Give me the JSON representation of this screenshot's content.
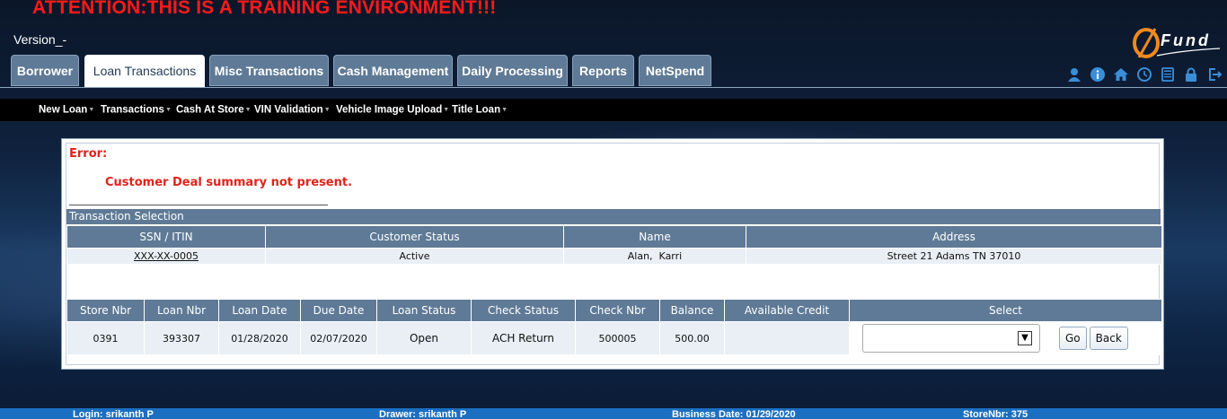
{
  "banner": {
    "attention": "ATTENTION:THIS IS A TRAINING ENVIRONMENT!!!",
    "version": "Version_-"
  },
  "logo": {
    "text": "Fund"
  },
  "tabs": [
    {
      "label": "Borrower"
    },
    {
      "label": "Loan Transactions",
      "active": true
    },
    {
      "label": "Misc Transactions"
    },
    {
      "label": "Cash Management"
    },
    {
      "label": "Daily Processing"
    },
    {
      "label": "Reports"
    },
    {
      "label": "NetSpend"
    }
  ],
  "toolbar_icons": [
    "user-icon",
    "info-icon",
    "home-icon",
    "clock-icon",
    "calculator-icon",
    "lock-icon",
    "logout-icon"
  ],
  "subnav": [
    {
      "label": "New Loan"
    },
    {
      "label": "Transactions"
    },
    {
      "label": "Cash At Store"
    },
    {
      "label": "VIN Validation"
    },
    {
      "label": "Vehicle Image Upload"
    },
    {
      "label": "Title Loan"
    }
  ],
  "error": {
    "title": "Error:",
    "message": "Customer Deal summary not present."
  },
  "section": {
    "title": "Transaction Selection"
  },
  "customer_table": {
    "headers": [
      "SSN / ITIN",
      "Customer Status",
      "Name",
      "Address"
    ],
    "row": {
      "ssn": "XXX-XX-0005",
      "status": "Active",
      "name": "Alan,  Karri",
      "address": "Street 21 Adams TN 37010"
    }
  },
  "loan_table": {
    "headers": [
      "Store Nbr",
      "Loan Nbr",
      "Loan Date",
      "Due Date",
      "Loan Status",
      "Check Status",
      "Check Nbr",
      "Balance",
      "Available Credit",
      "Select"
    ],
    "row": {
      "store_nbr": "0391",
      "loan_nbr": "393307",
      "loan_date": "01/28/2020",
      "due_date": "02/07/2020",
      "loan_status": "Open",
      "check_status": "ACH Return",
      "check_nbr": "500005",
      "balance": "500.00",
      "available_credit": "",
      "select_value": ""
    }
  },
  "buttons": {
    "go": "Go",
    "back": "Back"
  },
  "footer": {
    "login": "Login: srikanth P",
    "drawer": "Drawer: srikanth P",
    "business_date": "Business Date: 01/29/2020",
    "store": "StoreNbr: 375"
  },
  "colors": {
    "accent": "#5f7a96",
    "error": "#e0231b",
    "footer": "#1b6fc0",
    "attention": "#ff1a1a"
  }
}
